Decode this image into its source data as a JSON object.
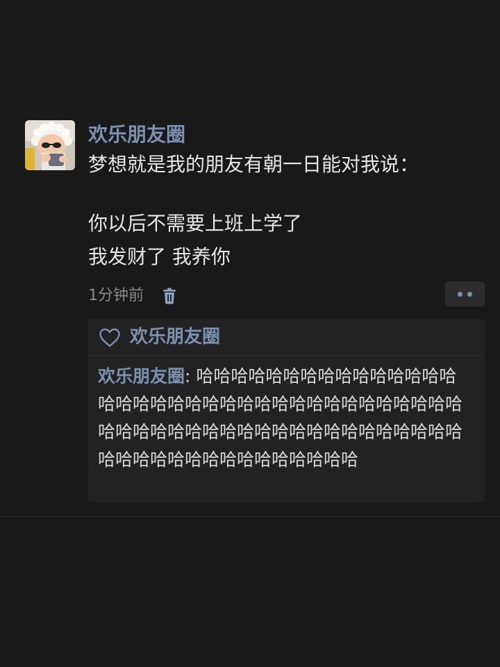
{
  "post": {
    "avatar_icon": "baby-avatar-photo",
    "username": "欢乐朋友圈",
    "text_lines": [
      "梦想就是我的朋友有朝一日能对我说：",
      "",
      "你以后不需要上班上学了",
      "我发财了 我养你"
    ],
    "time": "1分钟前",
    "delete_icon": "trash-icon",
    "more_icon": "more-dots-icon"
  },
  "interactions": {
    "like_icon": "heart-icon",
    "liked_by": "欢乐朋友圈",
    "comments": [
      {
        "author": "欢乐朋友圈",
        "separator": ": ",
        "text": "哈哈哈哈哈哈哈哈哈哈哈哈哈哈哈哈哈哈哈哈哈哈哈哈哈哈哈哈哈哈哈哈哈哈哈哈哈哈哈哈哈哈哈哈哈哈哈哈哈哈哈哈哈哈哈哈哈哈哈哈哈哈哈哈哈哈哈哈哈哈哈哈"
      }
    ]
  },
  "colors": {
    "background": "#191919",
    "name_blue": "#7d90b0",
    "text": "#e6e6e6",
    "muted": "#8a8a8a",
    "panel": "#222222"
  }
}
